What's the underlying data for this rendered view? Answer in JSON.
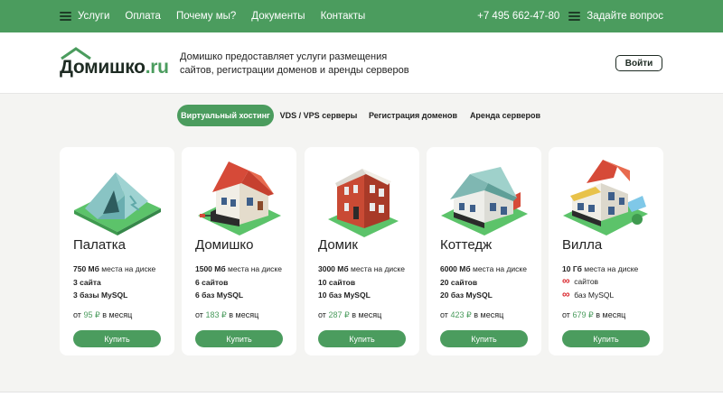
{
  "topbar": {
    "services": "Услуги",
    "links": [
      "Оплата",
      "Почему мы?",
      "Документы",
      "Контакты"
    ],
    "phone": "+7 495 662-47-80",
    "ask": "Задайте вопрос"
  },
  "header": {
    "logo_main": "Домишко",
    "logo_suffix": ".ru",
    "tagline": "Домишко предоставляет услуги размещения сайтов, регистрации доменов и аренды серверов",
    "login": "Войти"
  },
  "tabs": [
    "Виртуальный хостинг",
    "VDS / VPS серверы",
    "Регистрация доменов",
    "Аренда серверов"
  ],
  "cards": [
    {
      "name": "Палатка",
      "disk_value": "750 Мб",
      "disk_label": "места на диске",
      "sites": "3 сайта",
      "db": "3 базы MySQL",
      "price_prefix": "от",
      "price": "95 ₽",
      "price_suffix": "в месяц",
      "buy": "Купить"
    },
    {
      "name": "Домишко",
      "disk_value": "1500 Мб",
      "disk_label": "места на диске",
      "sites": "6 сайтов",
      "db": "6 баз MySQL",
      "price_prefix": "от",
      "price": "183 ₽",
      "price_suffix": "в месяц",
      "buy": "Купить"
    },
    {
      "name": "Домик",
      "disk_value": "3000 Мб",
      "disk_label": "места на диске",
      "sites": "10 сайтов",
      "db": "10 баз MySQL",
      "price_prefix": "от",
      "price": "287 ₽",
      "price_suffix": "в месяц",
      "buy": "Купить"
    },
    {
      "name": "Коттедж",
      "disk_value": "6000 Мб",
      "disk_label": "места на диске",
      "sites": "20 сайтов",
      "db": "20 баз MySQL",
      "price_prefix": "от",
      "price": "423 ₽",
      "price_suffix": "в месяц",
      "buy": "Купить"
    },
    {
      "name": "Вилла",
      "disk_value": "10 Гб",
      "disk_label": "места на диске",
      "sites_symbol": "∞",
      "sites_label": "сайтов",
      "db_symbol": "∞",
      "db_label": "баз MySQL",
      "price_prefix": "от",
      "price": "679 ₽",
      "price_suffix": "в месяц",
      "buy": "Купить"
    }
  ],
  "icons": [
    "menu-icon",
    "tent-icon",
    "small-house-icon",
    "brick-house-icon",
    "cottage-icon",
    "villa-icon"
  ],
  "colors": {
    "accent": "#4b9c5e",
    "dark": "#1e2b23",
    "infinity": "#d9262c",
    "background": "#f4f4f2"
  }
}
